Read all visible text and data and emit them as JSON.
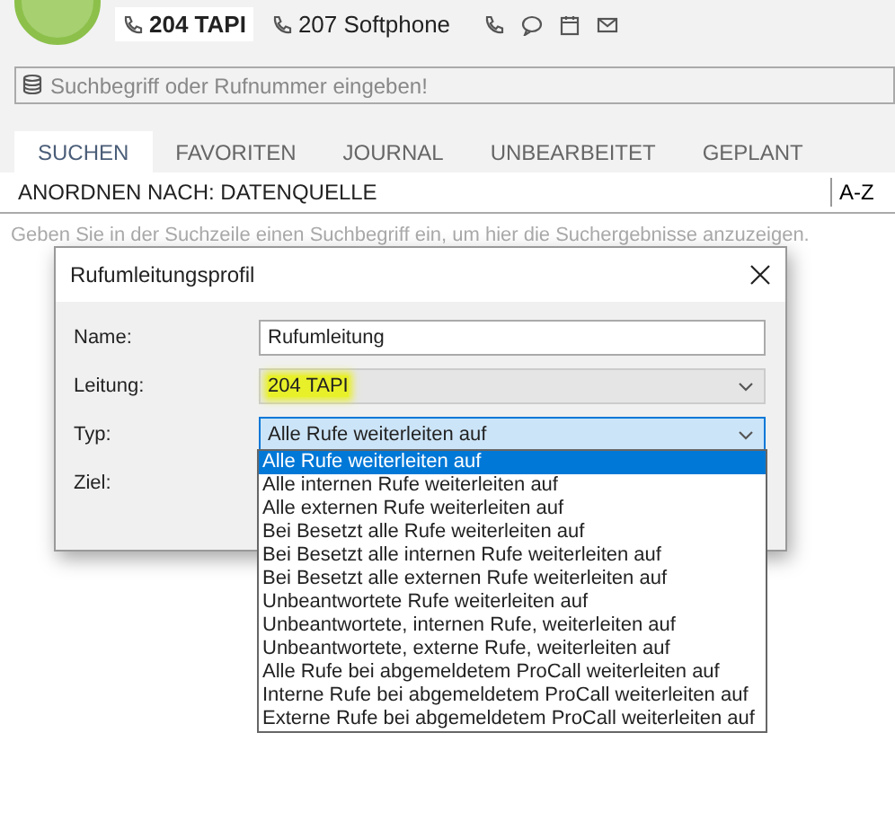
{
  "header": {
    "lines": [
      {
        "label": "204 TAPI",
        "selected": true
      },
      {
        "label": "207 Softphone",
        "selected": false
      }
    ]
  },
  "search": {
    "placeholder": "Suchbegriff oder Rufnummer eingeben!"
  },
  "tabs": [
    {
      "label": "SUCHEN",
      "selected": true
    },
    {
      "label": "FAVORITEN",
      "selected": false
    },
    {
      "label": "JOURNAL",
      "selected": false
    },
    {
      "label": "UNBEARBEITET",
      "selected": false
    },
    {
      "label": "GEPLANT",
      "selected": false
    }
  ],
  "sort": {
    "label": "ANORDNEN NACH: DATENQUELLE",
    "order": "A-Z"
  },
  "hint": "Geben Sie in der Suchzeile einen Suchbegriff ein, um hier die Suchergebnisse anzuzeigen.",
  "dialog": {
    "title": "Rufumleitungsprofil",
    "fields": [
      {
        "label": "Name:",
        "kind": "text",
        "value": "Rufumleitung"
      },
      {
        "label": "Leitung:",
        "kind": "select",
        "value": "204 TAPI",
        "disabled": true,
        "highlighted": true
      },
      {
        "label": "Typ:",
        "kind": "select",
        "value": "Alle Rufe weiterleiten auf",
        "disabled": false,
        "expanded": true,
        "options": [
          {
            "label": "Alle Rufe weiterleiten auf",
            "selected": true
          },
          {
            "label": "Alle internen Rufe weiterleiten auf",
            "selected": false
          },
          {
            "label": "Alle externen Rufe weiterleiten auf",
            "selected": false
          },
          {
            "label": "Bei Besetzt alle Rufe weiterleiten auf",
            "selected": false
          },
          {
            "label": "Bei Besetzt alle internen Rufe weiterleiten auf",
            "selected": false
          },
          {
            "label": "Bei Besetzt alle externen Rufe weiterleiten auf",
            "selected": false
          },
          {
            "label": "Unbeantwortete Rufe weiterleiten auf",
            "selected": false
          },
          {
            "label": "Unbeantwortete, internen Rufe, weiterleiten auf",
            "selected": false
          },
          {
            "label": "Unbeantwortete, externe Rufe, weiterleiten auf",
            "selected": false
          },
          {
            "label": "Alle Rufe bei abgemeldetem ProCall weiterleiten auf",
            "selected": false
          },
          {
            "label": "Interne Rufe bei abgemeldetem ProCall weiterleiten auf",
            "selected": false
          },
          {
            "label": "Externe Rufe bei abgemeldetem ProCall weiterleiten auf",
            "selected": false
          }
        ]
      },
      {
        "label": "Ziel:",
        "kind": "empty"
      }
    ]
  }
}
